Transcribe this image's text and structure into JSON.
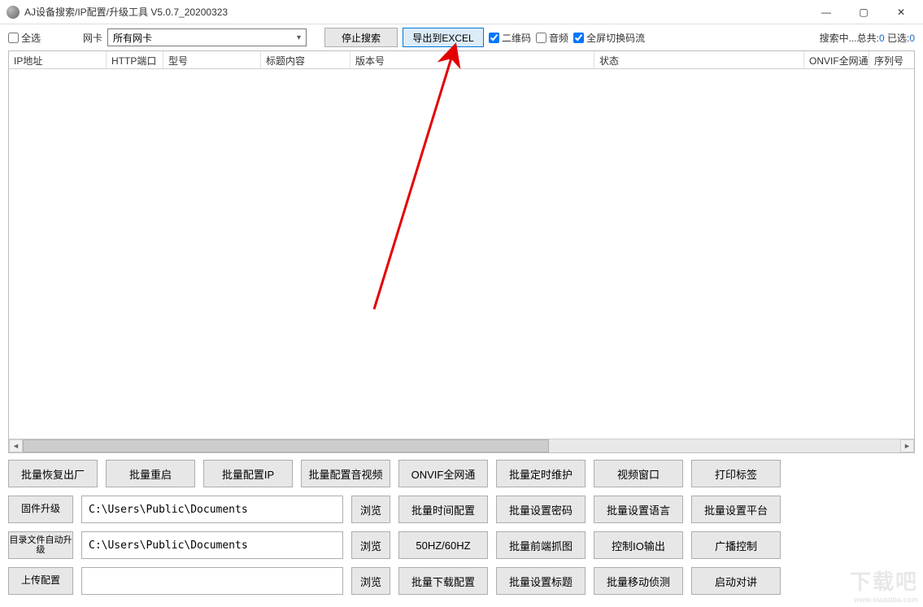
{
  "window": {
    "title": "AJ设备搜索/IP配置/升级工具 V5.0.7_20200323"
  },
  "toolbar": {
    "select_all": "全选",
    "nic_label": "网卡",
    "nic_value": "所有网卡",
    "stop_search": "停止搜索",
    "export_excel": "导出到EXCEL",
    "qrcode": "二维码",
    "audio": "音频",
    "fullscreen_switch": "全屏切换码流",
    "status_prefix": "搜索中...总共:",
    "total": "0",
    "selected_label": " 已选:",
    "selected": "0"
  },
  "columns": {
    "ip": "IP地址",
    "http_port": "HTTP端口",
    "model": "型号",
    "title_content": "标题内容",
    "version": "版本号",
    "status": "状态",
    "onvif": "ONVIF全网通",
    "serial": "序列号"
  },
  "row1": {
    "restore": "批量恢复出厂",
    "reboot": "批量重启",
    "config_ip": "批量配置IP",
    "config_av": "批量配置音视频",
    "onvif": "ONVIF全网通",
    "sched": "批量定时维护",
    "video_win": "视频窗口",
    "print_label": "打印标签"
  },
  "row2": {
    "firmware": "固件升级",
    "path": "C:\\Users\\Public\\Documents",
    "browse": "浏览",
    "time_cfg": "批量时间配置",
    "pwd": "批量设置密码",
    "lang": "批量设置语言",
    "platform": "批量设置平台"
  },
  "row3": {
    "dir_upgrade": "目录文件自动升级",
    "path": "C:\\Users\\Public\\Documents",
    "browse": "浏览",
    "hz": "50HZ/60HZ",
    "snap": "批量前端抓图",
    "io": "控制IO输出",
    "broadcast": "广播控制"
  },
  "row4": {
    "upload_cfg": "上传配置",
    "path": "",
    "browse": "浏览",
    "download_cfg": "批量下载配置",
    "title": "批量设置标题",
    "motion": "批量移动侦测",
    "talk": "启动对讲"
  },
  "watermark": {
    "text": "下载吧",
    "url": "www.xiazaiba.com"
  }
}
